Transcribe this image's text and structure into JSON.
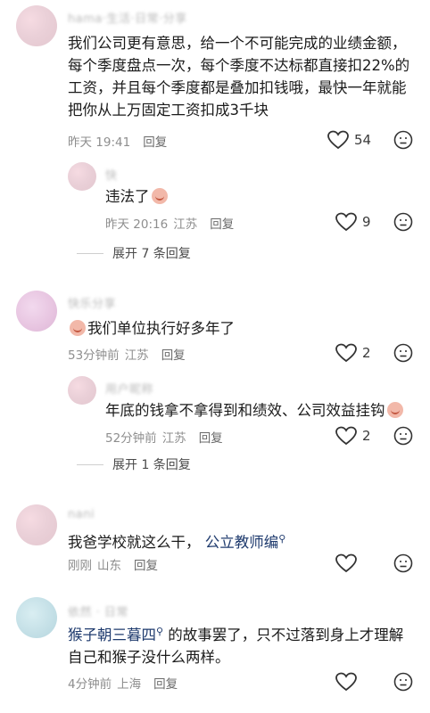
{
  "comments": [
    {
      "username": "hama·生活·日常·分享",
      "text": "我们公司更有意思，给一个不可能完成的业绩金额，每个季度盘点一次，每个季度不达标都直接扣22%的工资，并且每个季度都是叠加扣钱哦，最快一年就能把你从上万固定工资扣成3千块",
      "time": "昨天 19:41",
      "location": "",
      "reply": "回复",
      "likes": "54"
    },
    {
      "username": "快",
      "text": "违法了",
      "time": "昨天 20:16",
      "location": "江苏",
      "reply": "回复",
      "likes": "9"
    },
    {
      "expand": "展开 7 条回复"
    },
    {
      "username": "快乐分享",
      "text": "我们单位执行好多年了",
      "time": "53分钟前",
      "location": "江苏",
      "reply": "回复",
      "likes": "2"
    },
    {
      "username": "用户昵称",
      "text": "年底的钱拿不拿得到和绩效、公司效益挂钩",
      "time": "52分钟前",
      "location": "江苏",
      "reply": "回复",
      "likes": "2"
    },
    {
      "expand": "展开 1 条回复"
    },
    {
      "username": "nani",
      "text_prefix": "我爸学校就这么干，",
      "link": "公立教师编",
      "time": "刚刚",
      "location": "山东",
      "reply": "回复"
    },
    {
      "username": "依然 · 日常",
      "link": "猴子朝三暮四",
      "text_suffix": " 的故事罢了，只不过落到身上才理解自己和猴子没什么两样。",
      "time": "4分钟前",
      "location": "上海",
      "reply": "回复"
    }
  ],
  "colors": {
    "link": "#1f3b6e",
    "meta": "#8e8e8e",
    "text": "#1b1b1b"
  },
  "icons": {
    "like": "heart-outline-icon",
    "dislike": "frown-face-icon",
    "emoji": "crying-face-emoji"
  }
}
